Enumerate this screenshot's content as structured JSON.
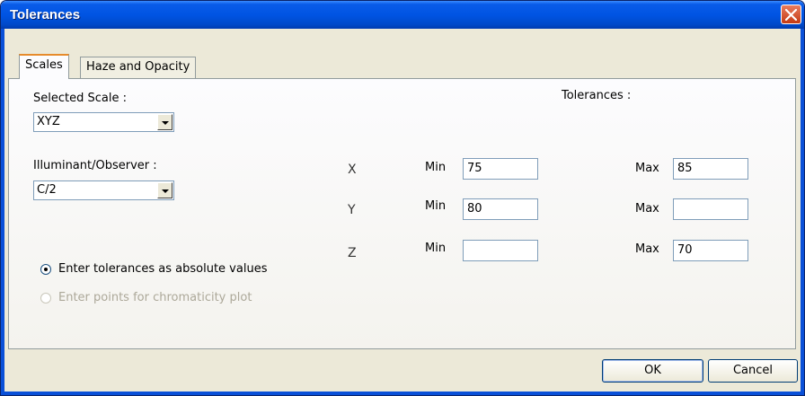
{
  "window": {
    "title": "Tolerances"
  },
  "tabs": [
    "Scales",
    "Haze and Opacity"
  ],
  "scales": {
    "selected_scale_label": "Selected Scale :",
    "selected_scale_value": "XYZ",
    "illuminant_label": "Illuminant/Observer :",
    "illuminant_value": "C/2",
    "tolerances_label": "Tolerances :",
    "rows": [
      {
        "axis": "X",
        "min_label": "Min",
        "min": "75",
        "max_label": "Max",
        "max": "85"
      },
      {
        "axis": "Y",
        "min_label": "Min",
        "min": "80",
        "max_label": "Max",
        "max": ""
      },
      {
        "axis": "Z",
        "min_label": "Min",
        "min": "",
        "max_label": "Max",
        "max": "70"
      }
    ],
    "radio_absolute": "Enter tolerances as absolute values",
    "radio_chromaticity": "Enter points for chromaticity plot"
  },
  "buttons": {
    "ok": "OK",
    "cancel": "Cancel"
  },
  "colors": {
    "title_bar": "#0054e3",
    "dialog_bg": "#ece9d8",
    "close_button": "#c53a13",
    "disabled_text": "#aca899"
  }
}
